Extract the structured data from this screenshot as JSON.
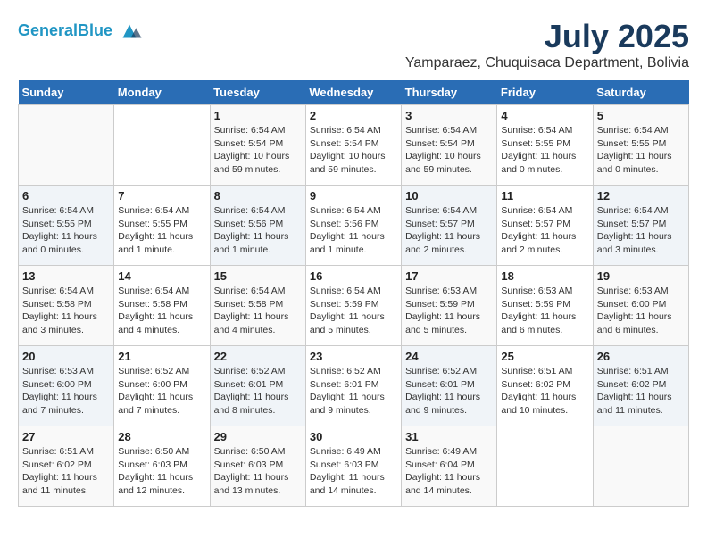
{
  "header": {
    "logo_line1": "General",
    "logo_line2": "Blue",
    "month_year": "July 2025",
    "location": "Yamparaez, Chuquisaca Department, Bolivia"
  },
  "weekdays": [
    "Sunday",
    "Monday",
    "Tuesday",
    "Wednesday",
    "Thursday",
    "Friday",
    "Saturday"
  ],
  "weeks": [
    [
      {
        "day": "",
        "info": ""
      },
      {
        "day": "",
        "info": ""
      },
      {
        "day": "1",
        "info": "Sunrise: 6:54 AM\nSunset: 5:54 PM\nDaylight: 10 hours and 59 minutes."
      },
      {
        "day": "2",
        "info": "Sunrise: 6:54 AM\nSunset: 5:54 PM\nDaylight: 10 hours and 59 minutes."
      },
      {
        "day": "3",
        "info": "Sunrise: 6:54 AM\nSunset: 5:54 PM\nDaylight: 10 hours and 59 minutes."
      },
      {
        "day": "4",
        "info": "Sunrise: 6:54 AM\nSunset: 5:55 PM\nDaylight: 11 hours and 0 minutes."
      },
      {
        "day": "5",
        "info": "Sunrise: 6:54 AM\nSunset: 5:55 PM\nDaylight: 11 hours and 0 minutes."
      }
    ],
    [
      {
        "day": "6",
        "info": "Sunrise: 6:54 AM\nSunset: 5:55 PM\nDaylight: 11 hours and 0 minutes."
      },
      {
        "day": "7",
        "info": "Sunrise: 6:54 AM\nSunset: 5:55 PM\nDaylight: 11 hours and 1 minute."
      },
      {
        "day": "8",
        "info": "Sunrise: 6:54 AM\nSunset: 5:56 PM\nDaylight: 11 hours and 1 minute."
      },
      {
        "day": "9",
        "info": "Sunrise: 6:54 AM\nSunset: 5:56 PM\nDaylight: 11 hours and 1 minute."
      },
      {
        "day": "10",
        "info": "Sunrise: 6:54 AM\nSunset: 5:57 PM\nDaylight: 11 hours and 2 minutes."
      },
      {
        "day": "11",
        "info": "Sunrise: 6:54 AM\nSunset: 5:57 PM\nDaylight: 11 hours and 2 minutes."
      },
      {
        "day": "12",
        "info": "Sunrise: 6:54 AM\nSunset: 5:57 PM\nDaylight: 11 hours and 3 minutes."
      }
    ],
    [
      {
        "day": "13",
        "info": "Sunrise: 6:54 AM\nSunset: 5:58 PM\nDaylight: 11 hours and 3 minutes."
      },
      {
        "day": "14",
        "info": "Sunrise: 6:54 AM\nSunset: 5:58 PM\nDaylight: 11 hours and 4 minutes."
      },
      {
        "day": "15",
        "info": "Sunrise: 6:54 AM\nSunset: 5:58 PM\nDaylight: 11 hours and 4 minutes."
      },
      {
        "day": "16",
        "info": "Sunrise: 6:54 AM\nSunset: 5:59 PM\nDaylight: 11 hours and 5 minutes."
      },
      {
        "day": "17",
        "info": "Sunrise: 6:53 AM\nSunset: 5:59 PM\nDaylight: 11 hours and 5 minutes."
      },
      {
        "day": "18",
        "info": "Sunrise: 6:53 AM\nSunset: 5:59 PM\nDaylight: 11 hours and 6 minutes."
      },
      {
        "day": "19",
        "info": "Sunrise: 6:53 AM\nSunset: 6:00 PM\nDaylight: 11 hours and 6 minutes."
      }
    ],
    [
      {
        "day": "20",
        "info": "Sunrise: 6:53 AM\nSunset: 6:00 PM\nDaylight: 11 hours and 7 minutes."
      },
      {
        "day": "21",
        "info": "Sunrise: 6:52 AM\nSunset: 6:00 PM\nDaylight: 11 hours and 7 minutes."
      },
      {
        "day": "22",
        "info": "Sunrise: 6:52 AM\nSunset: 6:01 PM\nDaylight: 11 hours and 8 minutes."
      },
      {
        "day": "23",
        "info": "Sunrise: 6:52 AM\nSunset: 6:01 PM\nDaylight: 11 hours and 9 minutes."
      },
      {
        "day": "24",
        "info": "Sunrise: 6:52 AM\nSunset: 6:01 PM\nDaylight: 11 hours and 9 minutes."
      },
      {
        "day": "25",
        "info": "Sunrise: 6:51 AM\nSunset: 6:02 PM\nDaylight: 11 hours and 10 minutes."
      },
      {
        "day": "26",
        "info": "Sunrise: 6:51 AM\nSunset: 6:02 PM\nDaylight: 11 hours and 11 minutes."
      }
    ],
    [
      {
        "day": "27",
        "info": "Sunrise: 6:51 AM\nSunset: 6:02 PM\nDaylight: 11 hours and 11 minutes."
      },
      {
        "day": "28",
        "info": "Sunrise: 6:50 AM\nSunset: 6:03 PM\nDaylight: 11 hours and 12 minutes."
      },
      {
        "day": "29",
        "info": "Sunrise: 6:50 AM\nSunset: 6:03 PM\nDaylight: 11 hours and 13 minutes."
      },
      {
        "day": "30",
        "info": "Sunrise: 6:49 AM\nSunset: 6:03 PM\nDaylight: 11 hours and 14 minutes."
      },
      {
        "day": "31",
        "info": "Sunrise: 6:49 AM\nSunset: 6:04 PM\nDaylight: 11 hours and 14 minutes."
      },
      {
        "day": "",
        "info": ""
      },
      {
        "day": "",
        "info": ""
      }
    ]
  ]
}
